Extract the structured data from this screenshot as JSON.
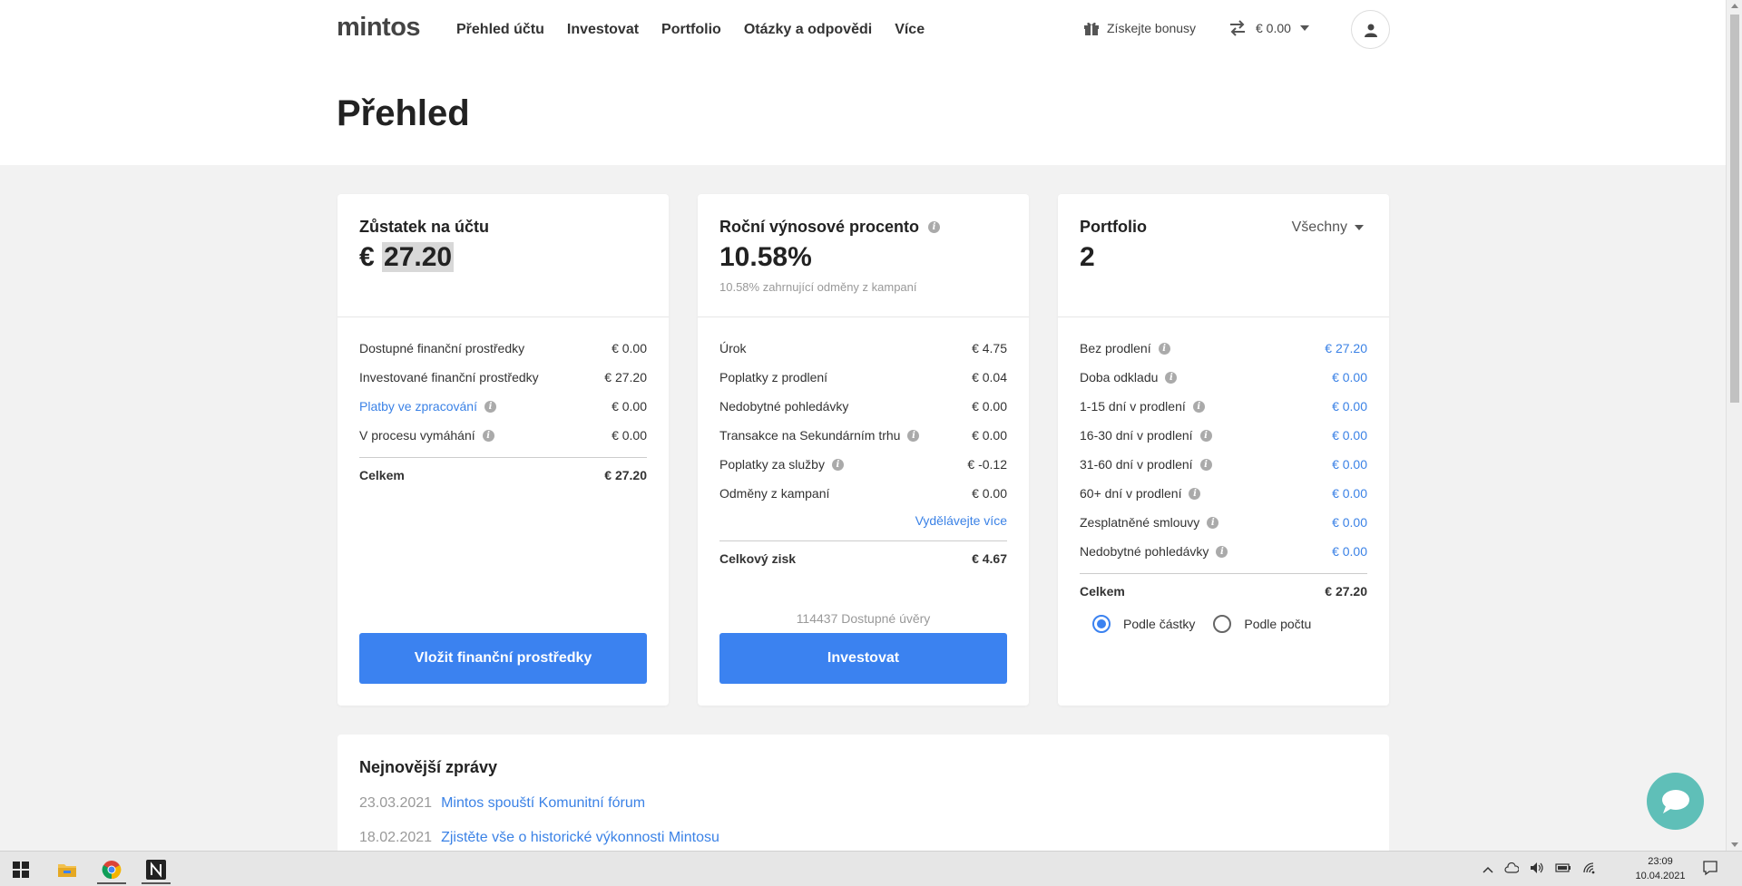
{
  "header": {
    "logo": "mintos",
    "nav": [
      "Přehled účtu",
      "Investovat",
      "Portfolio",
      "Otázky a odpovědi",
      "Více"
    ],
    "bonus_label": "Získejte bonusy",
    "balance": "€ 0.00"
  },
  "page_title": "Přehled",
  "balance_card": {
    "title": "Zůstatek na účtu",
    "currency": "€",
    "amount": "27.20",
    "rows": [
      {
        "label": "Dostupné finanční prostředky",
        "value": "€ 0.00"
      },
      {
        "label": "Investované finanční prostředky",
        "value": "€ 27.20"
      },
      {
        "label": "Platby ve zpracování",
        "value": "€ 0.00"
      },
      {
        "label": "V procesu vymáhání",
        "value": "€ 0.00"
      }
    ],
    "total_label": "Celkem",
    "total_value": "€ 27.20",
    "button": "Vložit finanční prostředky"
  },
  "return_card": {
    "title": "Roční výnosové procento",
    "value": "10.58%",
    "sub": "10.58% zahrnující odměny z kampaní",
    "rows": [
      {
        "label": "Úrok",
        "value": "€ 4.75"
      },
      {
        "label": "Poplatky z prodlení",
        "value": "€ 0.04"
      },
      {
        "label": "Nedobytné pohledávky",
        "value": "€ 0.00"
      },
      {
        "label": "Transakce na Sekundárním trhu",
        "value": "€ 0.00"
      },
      {
        "label": "Poplatky za služby",
        "value": "€ -0.12"
      },
      {
        "label": "Odměny z kampaní",
        "value": "€ 0.00"
      }
    ],
    "more_link": "Vydělávejte více",
    "total_label": "Celkový zisk",
    "total_value": "€ 4.67",
    "loans_note": "114437 Dostupné úvěry",
    "button": "Investovat"
  },
  "portfolio_card": {
    "title": "Portfolio",
    "value": "2",
    "filter": "Všechny",
    "rows": [
      {
        "label": "Bez prodlení",
        "value": "€ 27.20"
      },
      {
        "label": "Doba odkladu",
        "value": "€ 0.00"
      },
      {
        "label": "1-15 dní v prodlení",
        "value": "€ 0.00"
      },
      {
        "label": "16-30 dní v prodlení",
        "value": "€ 0.00"
      },
      {
        "label": "31-60 dní v prodlení",
        "value": "€ 0.00"
      },
      {
        "label": "60+ dní v prodlení",
        "value": "€ 0.00"
      },
      {
        "label": "Zesplatněné smlouvy",
        "value": "€ 0.00"
      },
      {
        "label": "Nedobytné pohledávky",
        "value": "€ 0.00"
      }
    ],
    "total_label": "Celkem",
    "total_value": "€ 27.20",
    "radio_amount": "Podle částky",
    "radio_count": "Podle počtu"
  },
  "news": {
    "title": "Nejnovější zprávy",
    "items": [
      {
        "date": "23.03.2021",
        "title": "Mintos spouští Komunitní fórum"
      },
      {
        "date": "18.02.2021",
        "title": "Zjistěte vše o historické výkonnosti Mintosu"
      }
    ]
  },
  "taskbar": {
    "time": "23:09",
    "date": "10.04.2021"
  }
}
